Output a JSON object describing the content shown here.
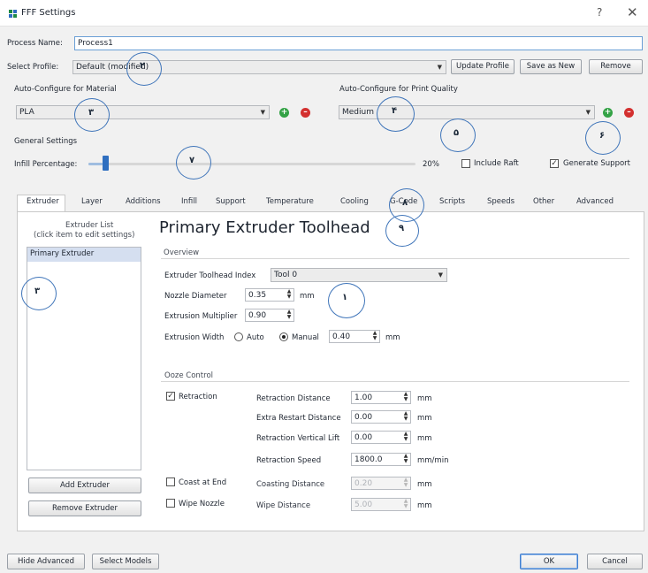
{
  "window": {
    "title": "FFF Settings",
    "help": "?",
    "close": "✕"
  },
  "process": {
    "name_label": "Process Name:",
    "name_value": "Process1",
    "profile_label": "Select Profile:",
    "profile_value": "Default (modified)",
    "update_profile": "Update Profile",
    "save_as_new": "Save as New",
    "remove": "Remove"
  },
  "material": {
    "label": "Auto-Configure for Material",
    "value": "PLA"
  },
  "quality": {
    "label": "Auto-Configure for Print Quality",
    "value": "Medium"
  },
  "general": {
    "label": "General Settings",
    "infill_label": "Infill Percentage:",
    "infill_value": "20%",
    "infill_fraction": 0.2,
    "include_raft": "Include Raft",
    "include_raft_checked": false,
    "generate_support": "Generate Support",
    "generate_support_checked": true
  },
  "tabs": [
    {
      "label": "Extruder",
      "active": true
    },
    {
      "label": "Layer"
    },
    {
      "label": "Additions"
    },
    {
      "label": "Infill"
    },
    {
      "label": "Support"
    },
    {
      "label": "Temperature"
    },
    {
      "label": "Cooling"
    },
    {
      "label": "G-Code"
    },
    {
      "label": "Scripts"
    },
    {
      "label": "Speeds"
    },
    {
      "label": "Other"
    },
    {
      "label": "Advanced"
    }
  ],
  "extruder_list": {
    "header_line1": "Extruder List",
    "header_line2": "(click item to edit settings)",
    "items": [
      "Primary Extruder"
    ],
    "add": "Add Extruder",
    "remove": "Remove Extruder"
  },
  "extruder": {
    "heading": "Primary Extruder Toolhead",
    "overview": "Overview",
    "toolhead_index_label": "Extruder Toolhead Index",
    "toolhead_index_value": "Tool 0",
    "nozzle_label": "Nozzle Diameter",
    "nozzle_value": "0.35",
    "nozzle_unit": "mm",
    "multiplier_label": "Extrusion Multiplier",
    "multiplier_value": "0.90",
    "width_label": "Extrusion Width",
    "width_auto": "Auto",
    "width_manual": "Manual",
    "width_value": "0.40",
    "width_unit": "mm"
  },
  "ooze": {
    "label": "Ooze Control",
    "retraction_label": "Retraction",
    "retraction_checked": true,
    "retraction_distance_label": "Retraction Distance",
    "retraction_distance_value": "1.00",
    "extra_restart_label": "Extra Restart Distance",
    "extra_restart_value": "0.00",
    "vertical_lift_label": "Retraction Vertical Lift",
    "vertical_lift_value": "0.00",
    "speed_label": "Retraction Speed",
    "speed_value": "1800.0",
    "mm": "mm",
    "speed_unit": "mm/min",
    "coast_label": "Coast at End",
    "coast_checked": false,
    "coasting_distance_label": "Coasting Distance",
    "coasting_distance_value": "0.20",
    "wipe_label": "Wipe Nozzle",
    "wipe_checked": false,
    "wipe_distance_label": "Wipe Distance",
    "wipe_distance_value": "5.00"
  },
  "annotations": [
    "۲",
    "۳",
    "۴",
    "۵",
    "۶",
    "۷",
    "۸",
    "۹",
    "۱"
  ],
  "footer": {
    "hide_advanced": "Hide Advanced",
    "select_models": "Select Models",
    "ok": "OK",
    "cancel": "Cancel"
  },
  "colors": {
    "add": "#33a245",
    "remove": "#d3302f",
    "annotation": "#3e74b9",
    "slider_handle": "#2f6fc0"
  }
}
